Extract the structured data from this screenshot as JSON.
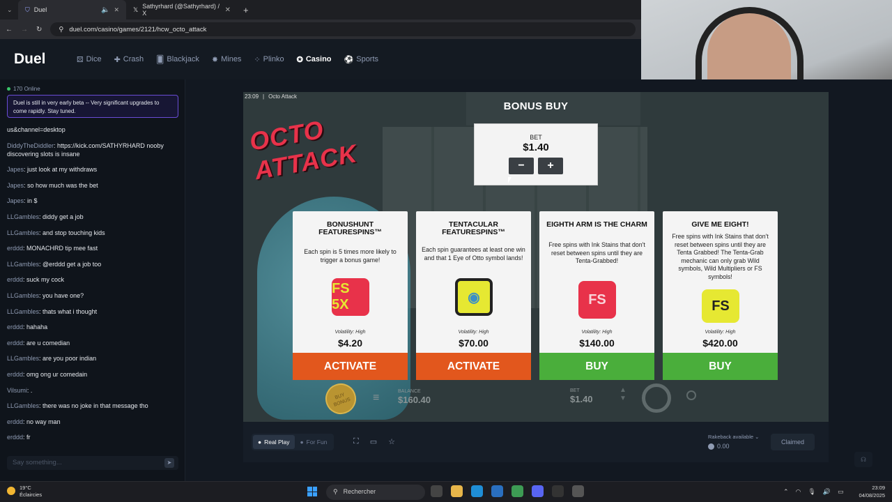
{
  "browser": {
    "tabs": [
      {
        "label": "Duel",
        "active": true
      },
      {
        "label": "Sathyrhard (@Sathyrhard) / X",
        "active": false
      }
    ],
    "url": "duel.com/casino/games/2121/hcw_octo_attack"
  },
  "site": {
    "logo": "Duel",
    "nav": [
      {
        "label": "Dice",
        "icon": "dice-icon"
      },
      {
        "label": "Crash",
        "icon": "crash-icon"
      },
      {
        "label": "Blackjack",
        "icon": "cards-icon"
      },
      {
        "label": "Mines",
        "icon": "mines-icon"
      },
      {
        "label": "Plinko",
        "icon": "plinko-icon"
      },
      {
        "label": "Casino",
        "icon": "casino-icon",
        "active": true
      },
      {
        "label": "Sports",
        "icon": "sports-icon"
      }
    ]
  },
  "chat": {
    "online": "170 Online",
    "notice": "Duel is still in very early beta -- Very significant upgrades to come rapidly. Stay tuned.",
    "messages": [
      {
        "user": "",
        "text": "us&channel=desktop"
      },
      {
        "user": "DiddyTheDiddler",
        "text": "https://kick.com/SATHYRHARD nooby discovering slots is insane"
      },
      {
        "user": "Japes",
        "text": "just look at my withdraws"
      },
      {
        "user": "Japes",
        "text": "so how much was the bet"
      },
      {
        "user": "Japes",
        "text": "in $"
      },
      {
        "user": "LLGambles",
        "text": "diddy get a job"
      },
      {
        "user": "LLGambles",
        "text": "and stop touching kids"
      },
      {
        "user": "erddd",
        "text": "MONACHRD tip mee fast"
      },
      {
        "user": "LLGambles",
        "text": " @erddd get a job too"
      },
      {
        "user": "erddd",
        "text": "suck my cock"
      },
      {
        "user": "LLGambles",
        "text": "you have one?"
      },
      {
        "user": "LLGambles",
        "text": "thats what i thought"
      },
      {
        "user": "erddd",
        "text": "hahaha"
      },
      {
        "user": "erddd",
        "text": "are u comedian"
      },
      {
        "user": "LLGambles",
        "text": "are you poor indian"
      },
      {
        "user": "erddd",
        "text": "omg ong ur comedain"
      },
      {
        "user": "Vilsumi",
        "text": "."
      },
      {
        "user": "LLGambles",
        "text": "there was no joke in that message tho"
      },
      {
        "user": "erddd",
        "text": "no way man"
      },
      {
        "user": "erddd",
        "text": "fr"
      }
    ],
    "input_placeholder": "Say something..."
  },
  "game": {
    "time": "23:09",
    "name": "Octo Attack",
    "logo_text": "OCTO ATTACK",
    "bonus_buy_title": "BONUS BUY",
    "bet": {
      "label": "BET",
      "value": "$1.40",
      "minus": "−",
      "plus": "+"
    },
    "cards": [
      {
        "title": "BONUSHUNT FEATURESPINS™",
        "desc": "Each spin is 5 times more likely to trigger a bonus game!",
        "badge": "FS 5X",
        "badge_color": "#e8324a",
        "volatility": "Volatility: High",
        "price": "$4.20",
        "action": "ACTIVATE",
        "action_color": "orange"
      },
      {
        "title": "TENTACULAR FEATURESPINS™",
        "desc": "Each spin guarantees at least one win and that 1 Eye of Otto symbol lands!",
        "badge": "◉",
        "badge_color": "#3b8fc6",
        "volatility": "Volatility: High",
        "price": "$70.00",
        "action": "ACTIVATE",
        "action_color": "orange"
      },
      {
        "title": "EIGHTH ARM IS THE CHARM",
        "desc": "Free spins with Ink Stains that don't reset between spins until they are Tenta-Grabbed!",
        "badge": "FS",
        "badge_color": "#e8324a",
        "volatility": "Volatility: High",
        "price": "$140.00",
        "action": "BUY",
        "action_color": "green"
      },
      {
        "title": "GIVE ME EIGHT!",
        "desc": "Free spins with Ink Stains that don't reset between spins until they are Tenta Grabbed! The Tenta-Grab mechanic can only grab Wild symbols, Wild Multipliers or FS symbols!",
        "badge": "FS",
        "badge_color": "#e6e832",
        "volatility": "Volatility: High",
        "price": "$420.00",
        "action": "BUY",
        "action_color": "green"
      }
    ],
    "bottom": {
      "buy_bonus": "BUY BONUS",
      "balance_label": "BALANCE",
      "balance": "$160.40",
      "bet_label": "BET",
      "bet": "$1.40"
    }
  },
  "footer": {
    "real_play": "Real Play",
    "for_fun": "For Fun",
    "rakeback_label": "Rakeback available",
    "rakeback_value": "0.00",
    "claimed": "Claimed"
  },
  "taskbar": {
    "temp": "19°C",
    "weather": "Éclaircies",
    "search": "Rechercher",
    "time": "23:09",
    "date": "04/08/2025"
  }
}
